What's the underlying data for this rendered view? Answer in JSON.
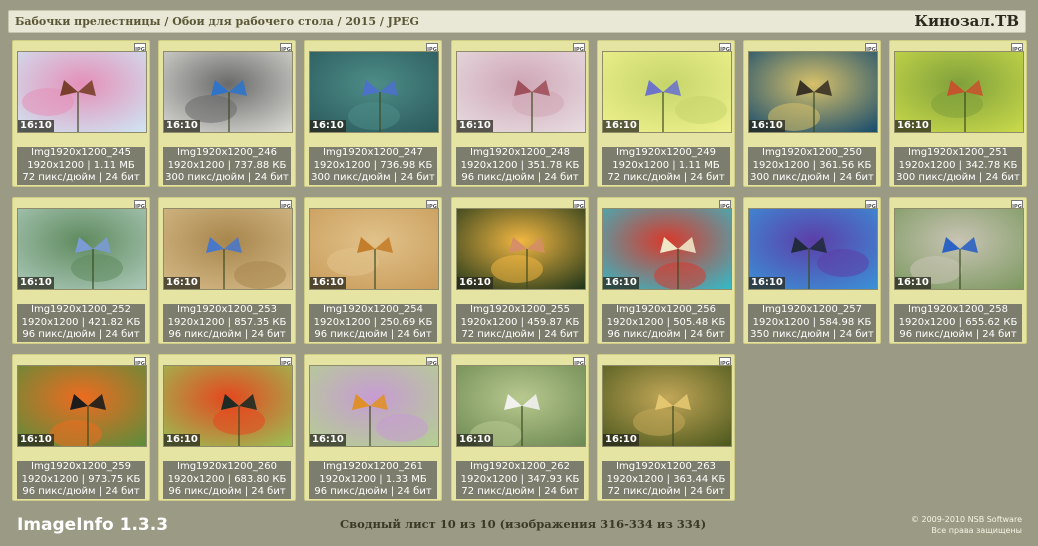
{
  "header": {
    "breadcrumb": "Бабочки прелестницы / Обои для рабочего стола / 2015 / JPEG",
    "brand": "Кинозал.ТВ"
  },
  "badge_label": "JPG",
  "ratio_label": "16:10",
  "thumbnails": [
    {
      "name": "Img1920x1200_245",
      "dims": "1920x1200 | 1.11 МБ",
      "res": "72 пикс/дюйм | 24 бит",
      "bg": "#cfe3f1",
      "accent": "#e58fb8",
      "subject": "#7a3f2a"
    },
    {
      "name": "Img1920x1200_246",
      "dims": "1920x1200 | 737.88 КБ",
      "res": "300 пикс/дюйм | 24 бит",
      "bg": "#d7d7d2",
      "accent": "#6a6a6a",
      "subject": "#2f74c9"
    },
    {
      "name": "Img1920x1200_247",
      "dims": "1920x1200 | 736.98 КБ",
      "res": "300 пикс/дюйм | 24 бит",
      "bg": "#2c5b5e",
      "accent": "#4d8d87",
      "subject": "#4b71c9"
    },
    {
      "name": "Img1920x1200_248",
      "dims": "1920x1200 | 351.78 КБ",
      "res": "96 пикс/дюйм | 24 бит",
      "bg": "#e7dbe0",
      "accent": "#cfa6b5",
      "subject": "#a0505c"
    },
    {
      "name": "Img1920x1200_249",
      "dims": "1920x1200 | 1.11 МБ",
      "res": "72 пикс/дюйм | 24 бит",
      "bg": "#eef08c",
      "accent": "#c6d66b",
      "subject": "#6d74c9"
    },
    {
      "name": "Img1920x1200_250",
      "dims": "1920x1200 | 361.56 КБ",
      "res": "300 пикс/дюйм | 24 бит",
      "bg": "#1d4f6d",
      "accent": "#d7c16a",
      "subject": "#3a3225"
    },
    {
      "name": "Img1920x1200_251",
      "dims": "1920x1200 | 342.78 КБ",
      "res": "300 пикс/дюйм | 24 бит",
      "bg": "#c8d84a",
      "accent": "#7fa03b",
      "subject": "#c4542c"
    },
    {
      "name": "Img1920x1200_252",
      "dims": "1920x1200 | 421.82 КБ",
      "res": "96 пикс/дюйм | 24 бит",
      "bg": "#a9c7b6",
      "accent": "#5f8a5e",
      "subject": "#7a9bd3"
    },
    {
      "name": "Img1920x1200_253",
      "dims": "1920x1200 | 857.35 КБ",
      "res": "96 пикс/дюйм | 24 бит",
      "bg": "#d4b987",
      "accent": "#a8864c",
      "subject": "#4a78c8"
    },
    {
      "name": "Img1920x1200_254",
      "dims": "1920x1200 | 250.69 КБ",
      "res": "96 пикс/дюйм | 24 бит",
      "bg": "#c99d5c",
      "accent": "#e1c28a",
      "subject": "#c47e2b"
    },
    {
      "name": "Img1920x1200_255",
      "dims": "1920x1200 | 459.87 КБ",
      "res": "72 пикс/дюйм | 24 бит",
      "bg": "#263a1b",
      "accent": "#f1b642",
      "subject": "#d58e65"
    },
    {
      "name": "Img1920x1200_256",
      "dims": "1920x1200 | 505.48 КБ",
      "res": "96 пикс/дюйм | 24 бит",
      "bg": "#39b6c3",
      "accent": "#d9392b",
      "subject": "#f0e7c8"
    },
    {
      "name": "Img1920x1200_257",
      "dims": "1920x1200 | 584.98 КБ",
      "res": "350 пикс/дюйм | 24 бит",
      "bg": "#3b8fd6",
      "accent": "#5d3ea8",
      "subject": "#222a3d"
    },
    {
      "name": "Img1920x1200_258",
      "dims": "1920x1200 | 655.62 КБ",
      "res": "96 пикс/дюйм | 24 бит",
      "bg": "#7f9a63",
      "accent": "#c8c4b4",
      "subject": "#2b62c3"
    },
    {
      "name": "Img1920x1200_259",
      "dims": "1920x1200 | 973.75 КБ",
      "res": "96 пикс/дюйм | 24 бит",
      "bg": "#5f8c3b",
      "accent": "#ee6b1f",
      "subject": "#1c1c1c"
    },
    {
      "name": "Img1920x1200_260",
      "dims": "1920x1200 | 683.80 КБ",
      "res": "96 пикс/дюйм | 24 бит",
      "bg": "#9bbd54",
      "accent": "#e5471e",
      "subject": "#1f2a24"
    },
    {
      "name": "Img1920x1200_261",
      "dims": "1920x1200 | 1.33 МБ",
      "res": "96 пикс/дюйм | 24 бит",
      "bg": "#b4cf92",
      "accent": "#c79bd4",
      "subject": "#e0902a"
    },
    {
      "name": "Img1920x1200_262",
      "dims": "1920x1200 | 347.93 КБ",
      "res": "72 пикс/дюйм | 24 бит",
      "bg": "#6f8b54",
      "accent": "#b8c98f",
      "subject": "#f1f1ee"
    },
    {
      "name": "Img1920x1200_263",
      "dims": "1920x1200 | 363.44 КБ",
      "res": "72 пикс/дюйм | 24 бит",
      "bg": "#4f5a1e",
      "accent": "#c2a758",
      "subject": "#e4c670"
    }
  ],
  "footer": {
    "app_name": "ImageInfo 1.3.3",
    "summary": "Сводный лист 10 из 10 (изображения 316-334 из 334)",
    "copyright": "© 2009-2010 NSB Software",
    "rights": "Все права защищены"
  }
}
